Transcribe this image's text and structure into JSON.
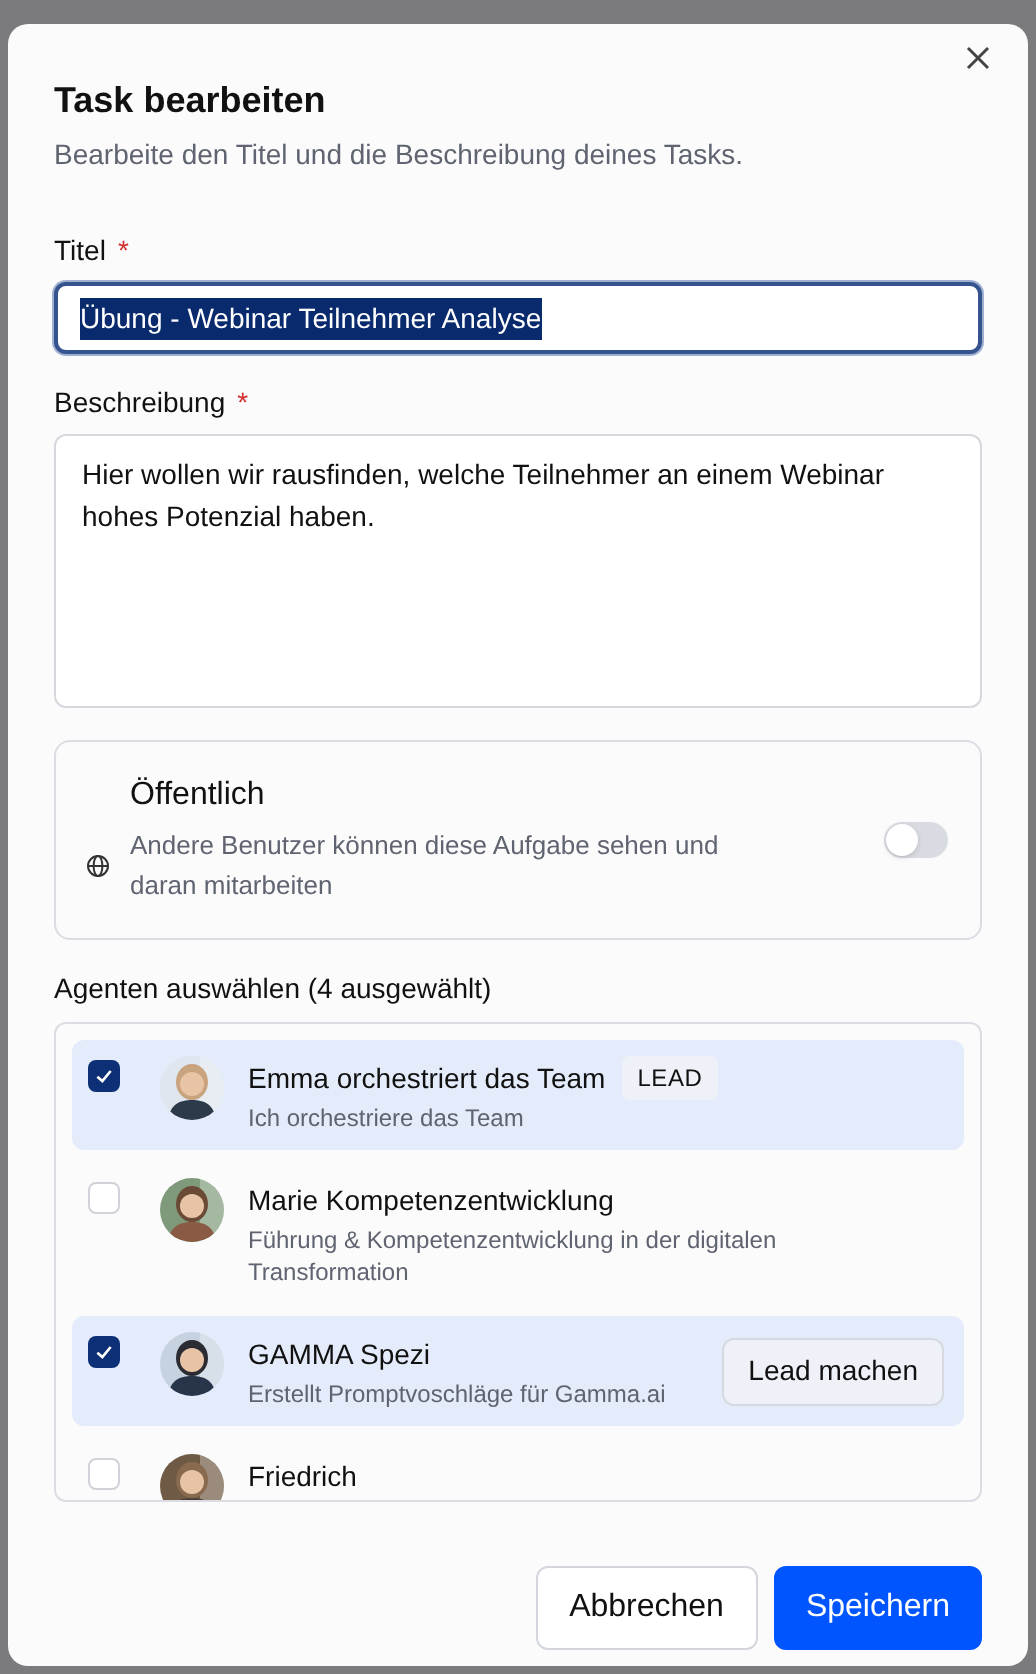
{
  "dialog": {
    "title": "Task bearbeiten",
    "subtitle": "Bearbeite den Titel und die Beschreibung deines Tasks."
  },
  "fields": [
    {
      "kind": "input",
      "label": "Titel",
      "required_mark": "*",
      "value": "Übung - Webinar Teilnehmer Analyse",
      "selected": true
    },
    {
      "kind": "textarea",
      "label": "Beschreibung",
      "required_mark": "*",
      "value": "Hier wollen wir rausfinden, welche Teilnehmer an einem Webinar hohes Potenzial haben."
    }
  ],
  "public": {
    "title": "Öffentlich",
    "description": "Andere Benutzer können diese Aufgabe sehen und daran mitarbeiten",
    "on": false
  },
  "agents": {
    "label": "Agenten auswählen (4 ausgewählt)",
    "items": [
      {
        "name": "Emma orchestriert das Team",
        "description": "Ich orchestriere das Team",
        "checked": true,
        "badge": "LEAD"
      },
      {
        "name": "Marie Kompetenzentwicklung",
        "description": "Führung & Kompetenzentwicklung in der digitalen Transformation",
        "checked": false
      },
      {
        "name": "GAMMA Spezi",
        "description": "Erstellt Promptvoschläge für Gamma.ai",
        "checked": true,
        "action": "Lead machen"
      },
      {
        "name": "Friedrich",
        "checked": false
      }
    ]
  },
  "buttons": [
    {
      "kind": "secondary",
      "label": "Abbrechen"
    },
    {
      "kind": "primary",
      "label": "Speichern"
    }
  ]
}
